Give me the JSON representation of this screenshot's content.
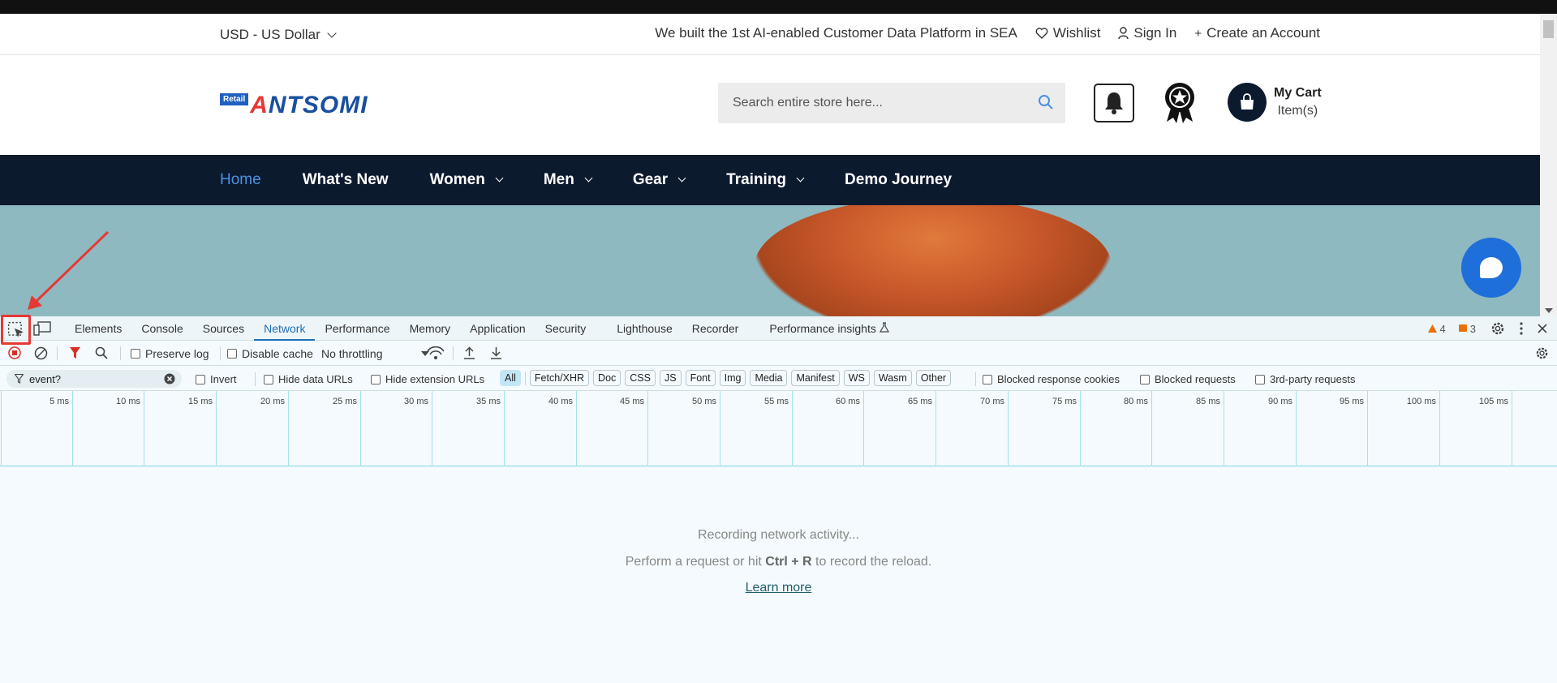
{
  "utility": {
    "currency": "USD - US Dollar",
    "promo": "We built the 1st AI-enabled Customer Data Platform in SEA",
    "wishlist": "Wishlist",
    "signin": "Sign In",
    "create_account": "Create an Account"
  },
  "header": {
    "logo_badge": "Retail",
    "logo_text_a": "A",
    "logo_text_rest": "NTSOMI",
    "search_placeholder": "Search entire store here...",
    "cart_title": "My Cart",
    "cart_items": "Item(s)"
  },
  "nav": {
    "items": [
      {
        "label": "Home"
      },
      {
        "label": "What's New"
      },
      {
        "label": "Women"
      },
      {
        "label": "Men"
      },
      {
        "label": "Gear"
      },
      {
        "label": "Training"
      },
      {
        "label": "Demo Journey"
      }
    ]
  },
  "devtools": {
    "tabs": [
      "Elements",
      "Console",
      "Sources",
      "Network",
      "Performance",
      "Memory",
      "Application",
      "Security",
      "Lighthouse",
      "Recorder",
      "Performance insights"
    ],
    "active_tab": "Network",
    "warnings": "4",
    "issues": "3",
    "toolbar": {
      "preserve_log": "Preserve log",
      "disable_cache": "Disable cache",
      "throttling": "No throttling"
    },
    "filter": {
      "value": "event?",
      "invert": "Invert",
      "hide_data_urls": "Hide data URLs",
      "hide_extension_urls": "Hide extension URLs",
      "types": [
        "All",
        "Fetch/XHR",
        "Doc",
        "CSS",
        "JS",
        "Font",
        "Img",
        "Media",
        "Manifest",
        "WS",
        "Wasm",
        "Other"
      ],
      "blocked_response_cookies": "Blocked response cookies",
      "blocked_requests": "Blocked requests",
      "third_party": "3rd-party requests"
    },
    "timeline_ticks": [
      "5 ms",
      "10 ms",
      "15 ms",
      "20 ms",
      "25 ms",
      "30 ms",
      "35 ms",
      "40 ms",
      "45 ms",
      "50 ms",
      "55 ms",
      "60 ms",
      "65 ms",
      "70 ms",
      "75 ms",
      "80 ms",
      "85 ms",
      "90 ms",
      "95 ms",
      "100 ms",
      "105 ms"
    ],
    "empty": {
      "line1": "Recording network activity...",
      "line2_pre": "Perform a request or hit ",
      "line2_key": "Ctrl + R",
      "line2_post": " to record the reload.",
      "learn_more": "Learn more"
    }
  },
  "colors": {
    "nav_bg": "#0c1a2e",
    "accent_blue": "#4a90e2",
    "annotation_red": "#e53935"
  }
}
